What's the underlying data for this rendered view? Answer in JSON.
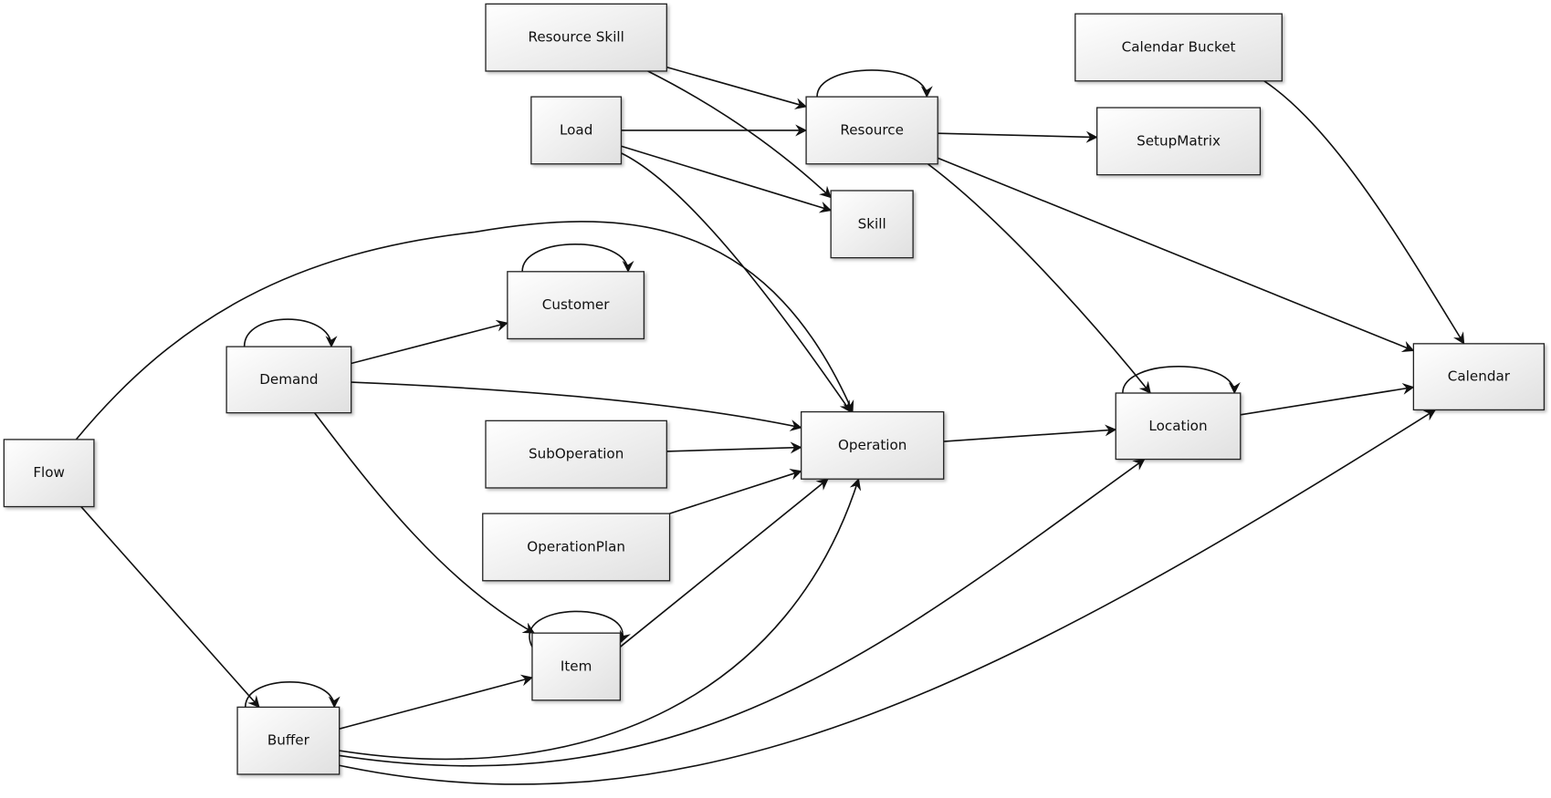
{
  "nodes": {
    "resource_skill": "Resource Skill",
    "calendar_bucket": "Calendar Bucket",
    "load": "Load",
    "resource": "Resource",
    "setup_matrix": "SetupMatrix",
    "skill": "Skill",
    "customer": "Customer",
    "demand": "Demand",
    "calendar": "Calendar",
    "location": "Location",
    "operation": "Operation",
    "flow": "Flow",
    "sub_operation": "SubOperation",
    "operation_plan": "OperationPlan",
    "item": "Item",
    "buffer": "Buffer"
  },
  "colors": {
    "box_top": "#ffffff",
    "box_bottom": "#e2e2e2",
    "stroke": "#111111"
  }
}
